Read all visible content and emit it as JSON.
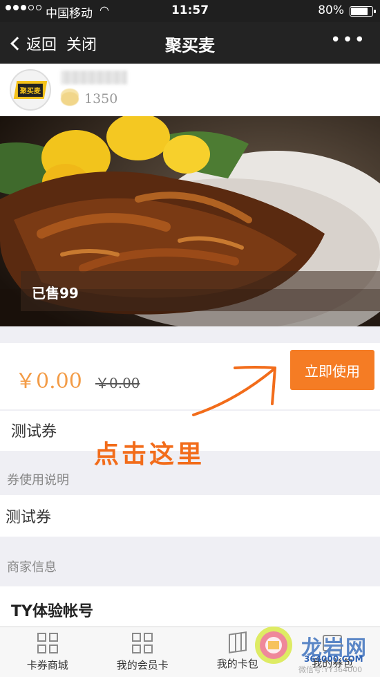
{
  "status_bar": {
    "carrier": "中国移动",
    "time": "11:57",
    "battery": "80%",
    "battery_level": 0.8,
    "signal_bars": 3,
    "signal_total": 5
  },
  "nav": {
    "back_label": "返回",
    "close_label": "关闭",
    "title": "聚买麦",
    "more_label": "•••"
  },
  "merchant": {
    "logo_text": "聚买麦",
    "coins": "1350"
  },
  "banner": {
    "sold_label": "已售99"
  },
  "price": {
    "current": "￥0.00",
    "original": "￥0.00",
    "use_button": "立即使用"
  },
  "coupon": {
    "name": "测试券",
    "usage_section_title": "券使用说明",
    "usage_text": "测试券",
    "merchant_section_title": "商家信息",
    "account_name": "TY体验帐号"
  },
  "annotation": {
    "text": "点击这里",
    "color": "#f26c1a"
  },
  "tabs": [
    {
      "label": "卡券商城",
      "icon": "grid-icon"
    },
    {
      "label": "我的会员卡",
      "icon": "grid-icon"
    },
    {
      "label": "我的卡包",
      "icon": "map-icon"
    },
    {
      "label": "我的券包",
      "icon": "wallet-icon"
    }
  ],
  "watermark": {
    "brand": "龙岩网",
    "url": "364000.COM",
    "small": "微信号:YY364000"
  },
  "colors": {
    "accent": "#f57c24",
    "price": "#f39c47",
    "nav_bg": "#232323"
  }
}
